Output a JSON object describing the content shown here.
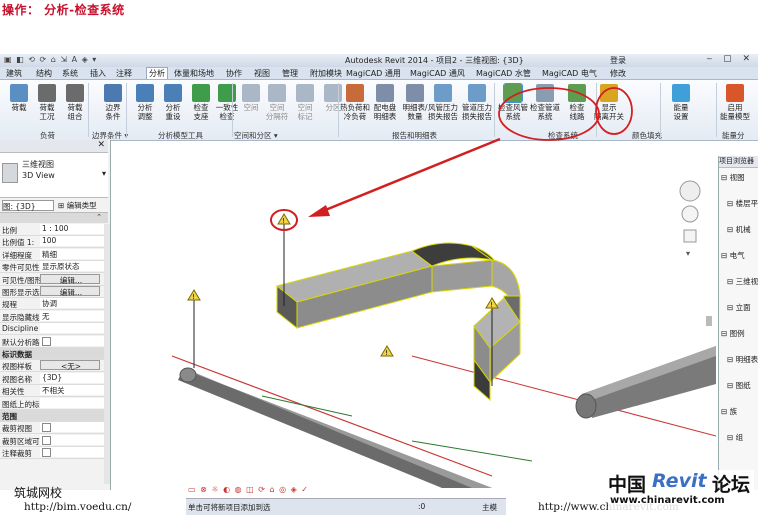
{
  "heading": "操作： 分析-检查系统",
  "titlebar": {
    "title": "Autodesk Revit 2014 -    项目2 - 三维视图: {3D}",
    "login": "登录"
  },
  "tabs": [
    "建筑",
    "结构",
    "系统",
    "插入",
    "注释",
    "分析",
    "体量和场地",
    "协作",
    "视图",
    "管理",
    "附加模块",
    "MagiCAD 通用",
    "MagiCAD 通风",
    "MagiCAD 水管",
    "MagiCAD 电气",
    "修改"
  ],
  "active_tab": "分析",
  "ribbon": {
    "buttons": [
      {
        "label": "荷载",
        "color": "#5a8fc4"
      },
      {
        "label": "荷载\n工况",
        "color": "#6b6b6b"
      },
      {
        "label": "荷载\n组合",
        "color": "#6b6b6b"
      },
      {
        "label": "边界\n条件",
        "color": "#4c79b0"
      },
      {
        "label": "分析\n调整",
        "color": "#4a7fb8"
      },
      {
        "label": "分析\n重设",
        "color": "#4a7fb8"
      },
      {
        "label": "检查\n支座",
        "color": "#3f9c4a"
      },
      {
        "label": "一致性\n检查",
        "color": "#3f9c4a"
      },
      {
        "label": "空间",
        "color": "#a9b7c6"
      },
      {
        "label": "空间\n分隔符",
        "color": "#a9b7c6"
      },
      {
        "label": "空间\n标记",
        "color": "#a9b7c6"
      },
      {
        "label": "分区",
        "color": "#a9b7c6"
      },
      {
        "label": "热负荷和\n冷负荷",
        "color": "#c96a3a"
      },
      {
        "label": "配电盘\n明细表",
        "color": "#7e8ea8"
      },
      {
        "label": "明细表/\n数量",
        "color": "#7e8ea8"
      },
      {
        "label": "风管压力\n损失报告",
        "color": "#6d9cc8"
      },
      {
        "label": "管道压力\n损失报告",
        "color": "#6d9cc8"
      },
      {
        "label": "检查风管\n系统",
        "color": "#5e9c52"
      },
      {
        "label": "检查管道\n系统",
        "color": "#8a9cb0"
      },
      {
        "label": "检查\n线路",
        "color": "#5e9c52"
      },
      {
        "label": "显示\n隔离开关",
        "color": "#d9a520"
      },
      {
        "label": "能量\n设置",
        "color": "#3f9fd8"
      },
      {
        "label": "启用\n能量模型",
        "color": "#d9562a"
      }
    ],
    "groups": [
      "负荷",
      "边界条件 ▾",
      "分析模型工具",
      "空间和分区 ▾",
      "报告和明细表",
      "检查系统",
      "颜色填充",
      "能量分"
    ]
  },
  "properties": {
    "type_name": "三维视图",
    "type_name_en": "3D View",
    "view_selector": "图: {3D}",
    "edit_type_label": "编辑类型",
    "rows": [
      {
        "k": "比例",
        "v": "1 : 100"
      },
      {
        "k": "比例值 1:",
        "v": "100"
      },
      {
        "k": "详细程度",
        "v": "精细"
      },
      {
        "k": "零件可见性",
        "v": "显示原状态"
      },
      {
        "k": "可见性/图形替换",
        "v": "编辑...",
        "btn": true
      },
      {
        "k": "图形显示选项",
        "v": "编辑...",
        "btn": true
      },
      {
        "k": "规程",
        "v": "协调"
      },
      {
        "k": "显示隐藏线",
        "v": "无"
      },
      {
        "k": "Discipline",
        "v": ""
      },
      {
        "k": "默认分析路径",
        "v": "",
        "chk": true
      },
      {
        "k": "标识数据",
        "v": "",
        "hd": true
      },
      {
        "k": "视图样板",
        "v": "<无>",
        "btn": true
      },
      {
        "k": "视图名称",
        "v": "{3D}"
      },
      {
        "k": "相关性",
        "v": "不相关"
      },
      {
        "k": "图纸上的标题",
        "v": ""
      },
      {
        "k": "范围",
        "v": "",
        "hd": true
      },
      {
        "k": "裁剪视图",
        "v": "",
        "chk": true
      },
      {
        "k": "裁剪区域可见",
        "v": "",
        "chk": true
      },
      {
        "k": "注释裁剪",
        "v": "",
        "chk": true
      }
    ]
  },
  "browser": {
    "title": "项目浏览器",
    "items": [
      "视图",
      "楼层平面",
      "机械",
      "电气",
      "三维视图",
      "立面",
      "图例",
      "明细表",
      "图纸",
      "族",
      "组"
    ]
  },
  "status": {
    "text": "单击可将新项目添加到选",
    "zero": ":0",
    "main": "主模"
  },
  "watermarks": {
    "left_name": "筑城网校",
    "left_url": "http://bim.voedu.cn/",
    "right_url": "http://www.chinarevit.com",
    "logo_cn": "中国",
    "logo_revit": "Revit",
    "logo_tail": "论坛",
    "logo_url": "www.chinarevit.com"
  },
  "colors": {
    "heading": "#c8102e",
    "annotation_red": "#d21f1f",
    "duct_fill": "#8c8c8c",
    "duct_outline": "#d8d800",
    "warning_yellow": "#f1d34a",
    "revit_blue": "#3a6fc4"
  }
}
